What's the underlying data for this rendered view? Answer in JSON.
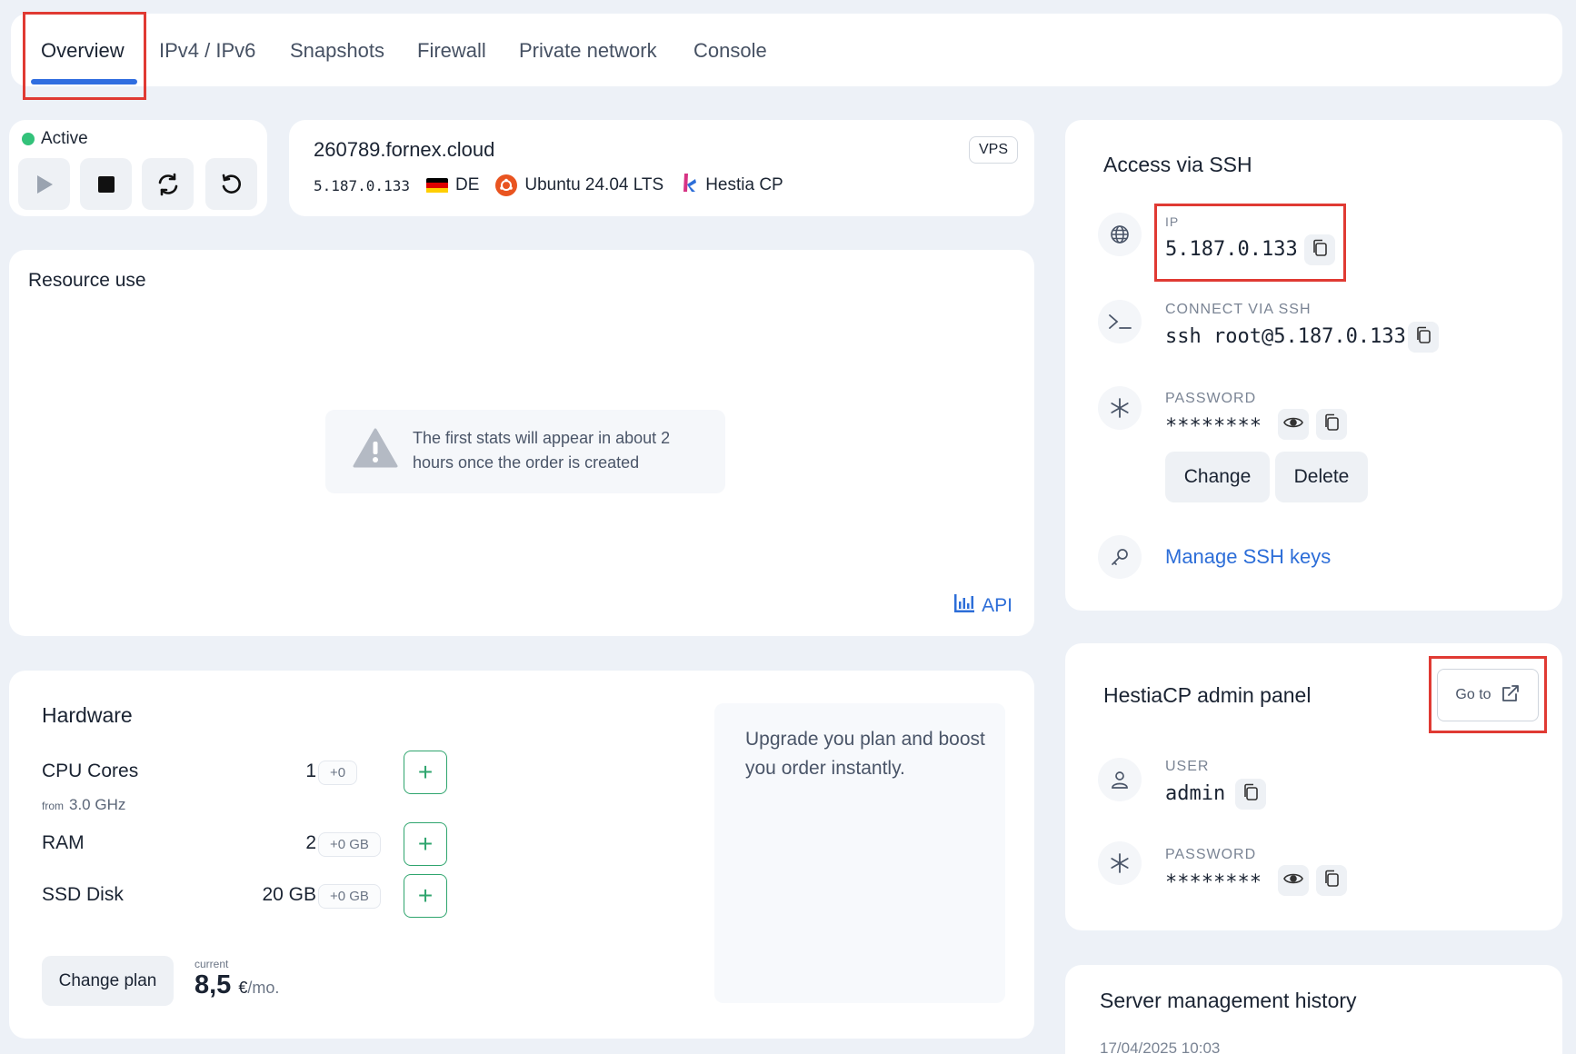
{
  "tabs": [
    {
      "label": "Overview",
      "active": true
    },
    {
      "label": "IPv4 / IPv6",
      "active": false
    },
    {
      "label": "Snapshots",
      "active": false
    },
    {
      "label": "Firewall",
      "active": false
    },
    {
      "label": "Private network",
      "active": false
    },
    {
      "label": "Console",
      "active": false
    }
  ],
  "status": {
    "label": "Active",
    "color": "#33c27a",
    "controls": [
      "play-icon",
      "stop-icon",
      "refresh-icon",
      "undo-icon"
    ]
  },
  "server": {
    "hostname": "260789.fornex.cloud",
    "badge": "VPS",
    "ip": "5.187.0.133",
    "country": "DE",
    "os": "Ubuntu 24.04 LTS",
    "panel": "Hestia CP"
  },
  "resource": {
    "title": "Resource use",
    "notice": "The first stats will appear in about 2 hours once the order is created",
    "api_label": "API"
  },
  "hardware": {
    "title": "Hardware",
    "rows": [
      {
        "label": "CPU Cores",
        "value": "1",
        "delta": "+0",
        "sub_prefix": "from",
        "sub_value": "3.0 GHz"
      },
      {
        "label": "RAM",
        "value": "2",
        "delta": "+0 GB"
      },
      {
        "label": "SSD Disk",
        "value": "20 GB",
        "delta": "+0 GB"
      }
    ],
    "change_plan_label": "Change plan",
    "price_caption": "current",
    "price": "8,5",
    "price_currency": "€",
    "price_period": "/mo.",
    "upgrade_text": "Upgrade you plan and boost you order instantly."
  },
  "ssh": {
    "title": "Access via SSH",
    "ip_label": "IP",
    "ip_value": "5.187.0.133",
    "connect_label": "CONNECT VIA SSH",
    "connect_value": "ssh root@5.187.0.133",
    "password_label": "PASSWORD",
    "password_value": "********",
    "change_label": "Change",
    "delete_label": "Delete",
    "manage_keys_label": "Manage SSH keys"
  },
  "hestia": {
    "title": "HestiaCP admin panel",
    "goto_label": "Go to",
    "user_label": "USER",
    "user_value": "admin",
    "password_label": "PASSWORD",
    "password_value": "********"
  },
  "history": {
    "title": "Server management history",
    "first_date": "17/04/2025 10:03"
  },
  "colors": {
    "accent": "#2f6de0",
    "link": "#2d6ed8",
    "success": "#2fa56e",
    "highlight": "#e03a33"
  }
}
